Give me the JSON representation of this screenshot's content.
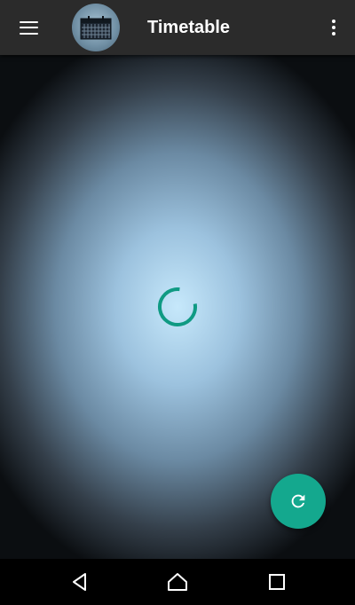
{
  "app_bar": {
    "title": "Timetable",
    "menu_icon": "hamburger-menu-icon",
    "logo_icon": "timetable-calendar-logo",
    "overflow_icon": "more-vert-icon"
  },
  "content": {
    "loading_indicator": "progress-spinner",
    "accent_color": "#0f9a83"
  },
  "fab": {
    "icon": "refresh-icon",
    "color": "#14a88e"
  },
  "system_nav": {
    "back_icon": "back-triangle-icon",
    "home_icon": "home-icon",
    "recents_icon": "recents-square-icon"
  }
}
